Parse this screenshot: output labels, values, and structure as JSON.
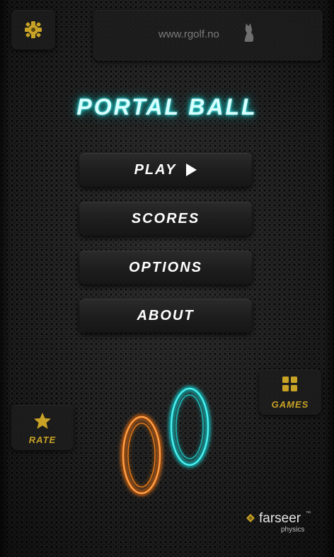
{
  "header": {
    "url": "www.rgolf.no",
    "settings_icon": "gear-icon",
    "cat_icon": "cat-icon"
  },
  "title": "PORTAL BALL",
  "menu": {
    "play_label": "PLAY",
    "scores_label": "SCORES",
    "options_label": "OPTIONS",
    "about_label": "ABOUT"
  },
  "corners": {
    "rate_label": "RATE",
    "rate_icon": "star-icon",
    "games_label": "GAMES",
    "games_icon": "grid-icon"
  },
  "portals": {
    "orange_color": "#ff8a1f",
    "cyan_color": "#27d9d9"
  },
  "footer": {
    "brand_name": "farseer",
    "brand_tm": "™",
    "brand_sub": "physics"
  },
  "colors": {
    "title_glow": "#1fc9c9",
    "accent_gold": "#c9a326",
    "button_text": "#ffffff"
  }
}
